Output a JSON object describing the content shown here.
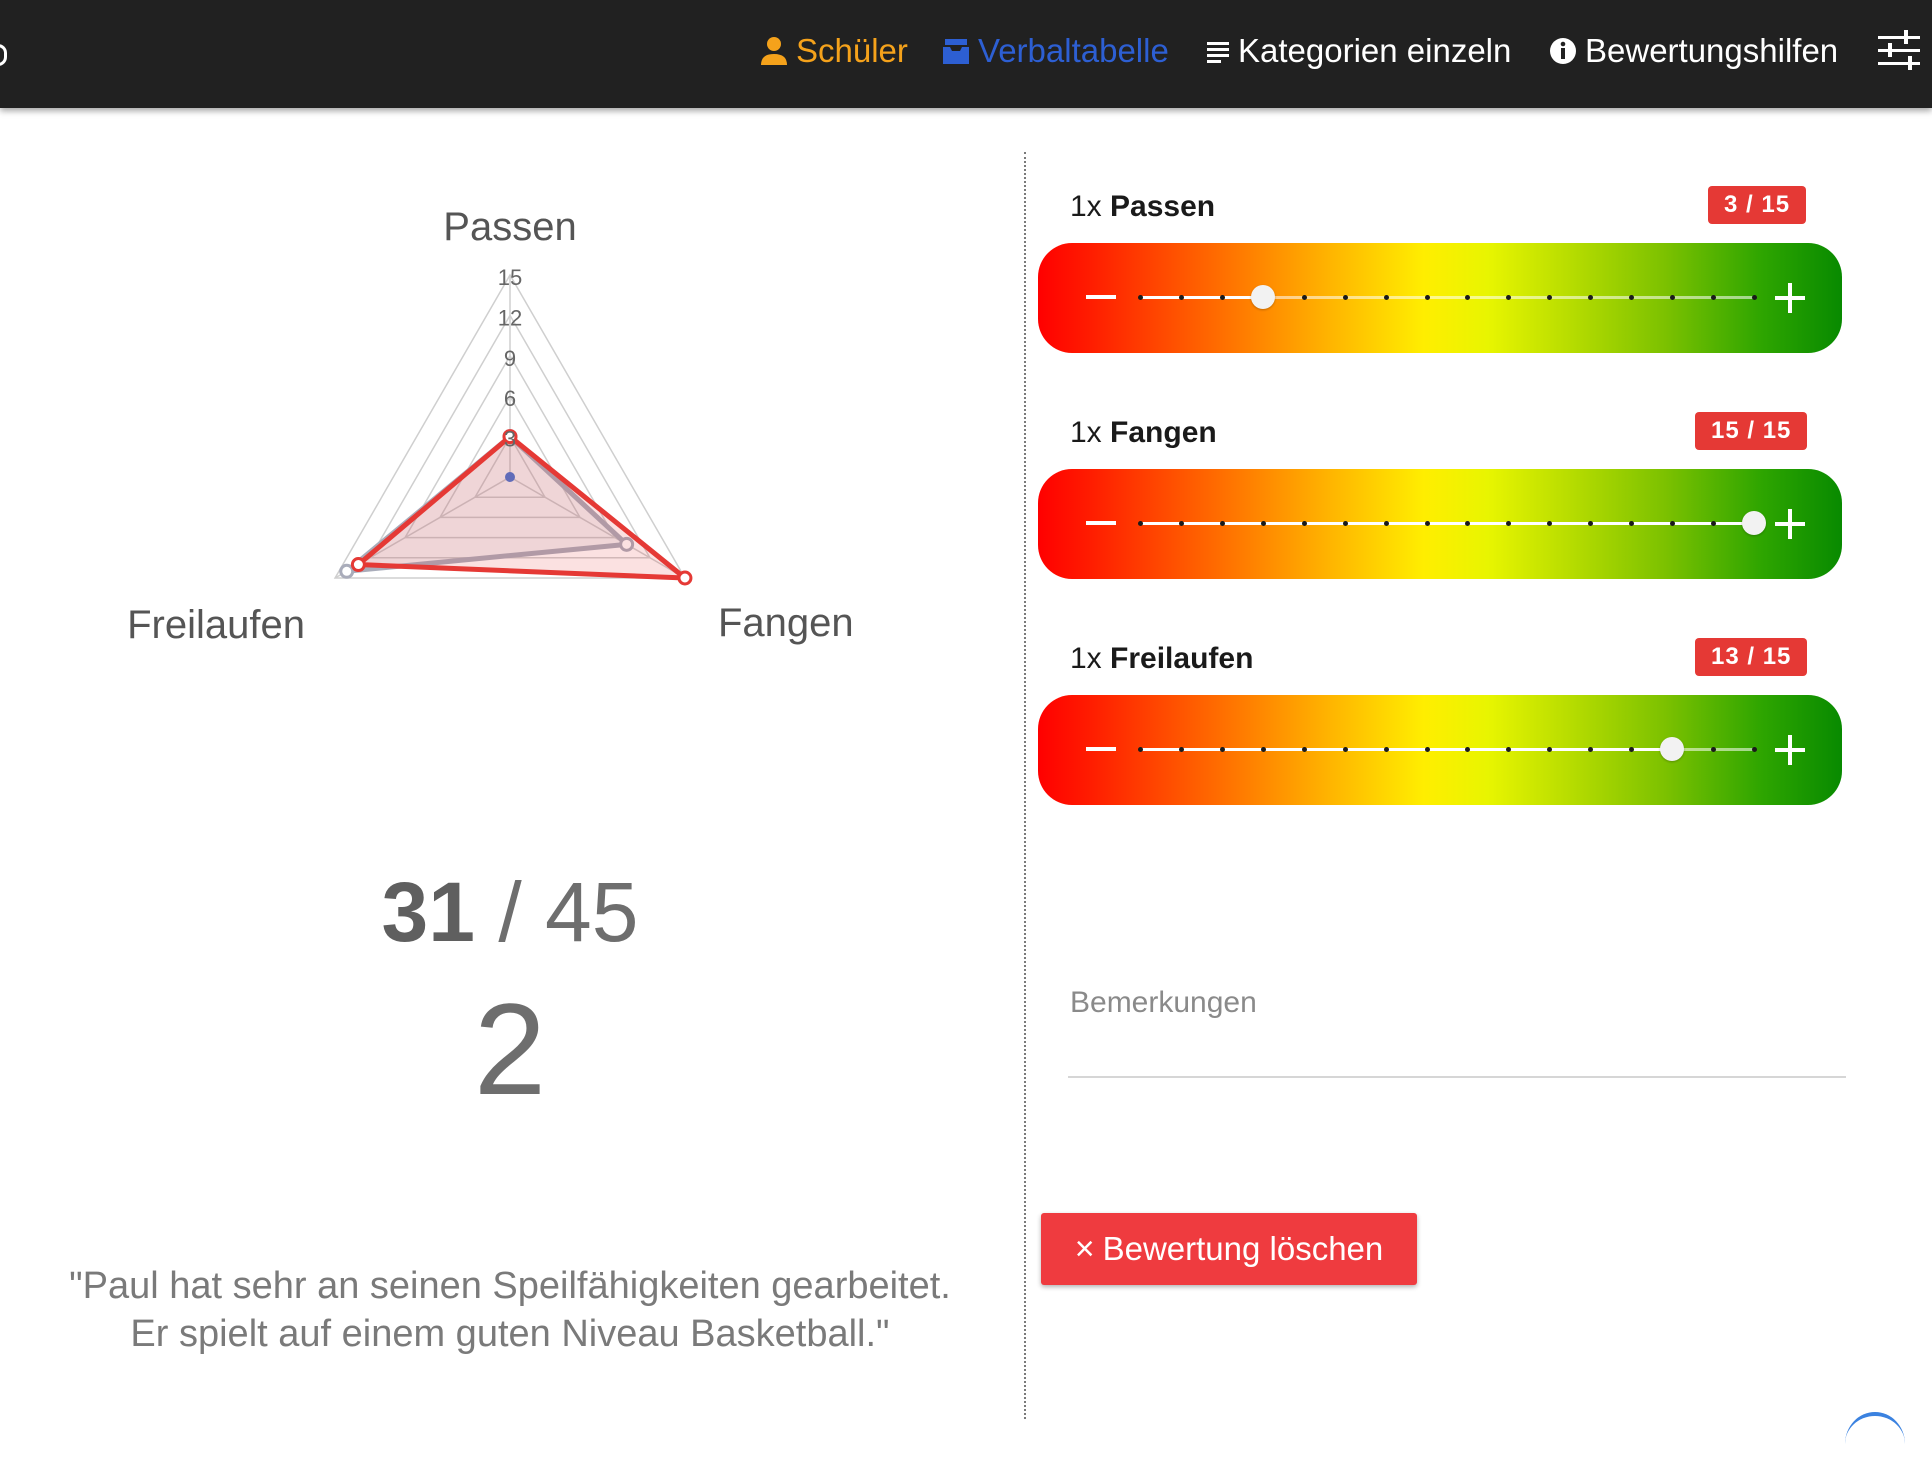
{
  "nav": {
    "schueler": "Schüler",
    "verbaltabelle": "Verbaltabelle",
    "kategorien": "Kategorien einzeln",
    "bewertungshilfen": "Bewertungshilfen",
    "colors": {
      "bar_bg": "#212121",
      "schueler": "#f5a21b",
      "active": "#2d5fd3",
      "default": "#ffffff"
    },
    "icons": [
      "person-icon",
      "archive-icon",
      "list-icon",
      "info-icon",
      "sliders-icon"
    ]
  },
  "chart_data": {
    "type": "radar",
    "axes": [
      "Passen",
      "Fangen",
      "Freilaufen"
    ],
    "scale": {
      "min": 0,
      "max": 15,
      "ticks": [
        3,
        6,
        9,
        12,
        15
      ]
    },
    "series": [
      {
        "color": "#e53935",
        "fill": "rgba(229,57,53,0.15)",
        "values": [
          3,
          15,
          13
        ]
      },
      {
        "color": "#a9acba",
        "fill": "rgba(160,160,180,0.15)",
        "values": [
          3,
          10,
          14
        ]
      },
      {
        "color": "#3b6fd6",
        "values": [
          0,
          0,
          0
        ]
      }
    ]
  },
  "score": {
    "total": "31",
    "separator": "/",
    "max": "45",
    "grade": "2"
  },
  "comment": {
    "line1": "\"Paul hat sehr an seinen Speilfähigkeiten gearbeitet.",
    "line2": "Er spielt auf einem guten Niveau Basketball.\""
  },
  "categories": [
    {
      "multiplier": "1x",
      "name": "Passen",
      "badge": "3 / 15",
      "value": 3,
      "max": 15
    },
    {
      "multiplier": "1x",
      "name": "Fangen",
      "badge": "15 / 15",
      "value": 15,
      "max": 15
    },
    {
      "multiplier": "1x",
      "name": "Freilaufen",
      "badge": "13 / 15",
      "value": 13,
      "max": 15
    }
  ],
  "remarks": {
    "label": "Bemerkungen",
    "value": ""
  },
  "delete_button": {
    "icon": "×",
    "label": "Bewertung löschen",
    "color": "#ef3b3f"
  }
}
